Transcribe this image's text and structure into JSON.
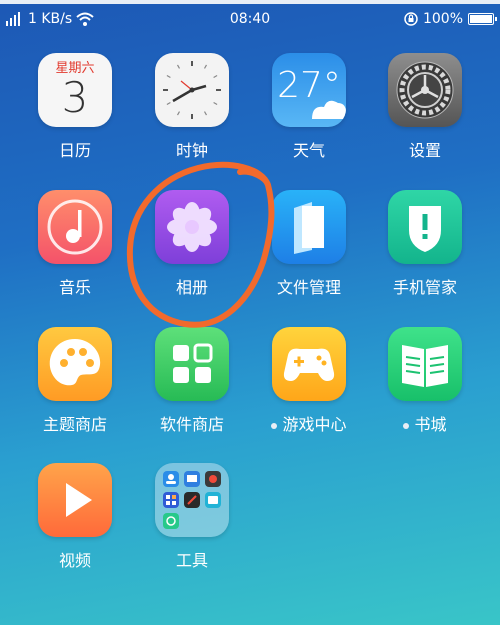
{
  "status_bar": {
    "network_speed": "1 KB/s",
    "time": "08:40",
    "battery_percent": "100%"
  },
  "apps": [
    {
      "label": "日历",
      "weekday": "星期六",
      "day": "3"
    },
    {
      "label": "时钟"
    },
    {
      "label": "天气",
      "temperature": "27°"
    },
    {
      "label": "设置"
    },
    {
      "label": "音乐"
    },
    {
      "label": "相册"
    },
    {
      "label": "文件管理"
    },
    {
      "label": "手机管家"
    },
    {
      "label": "主题商店"
    },
    {
      "label": "软件商店"
    },
    {
      "label": "游戏中心"
    },
    {
      "label": "书城"
    },
    {
      "label": "视频"
    },
    {
      "label": "工具"
    }
  ],
  "annotation_color": "#f26a2c"
}
